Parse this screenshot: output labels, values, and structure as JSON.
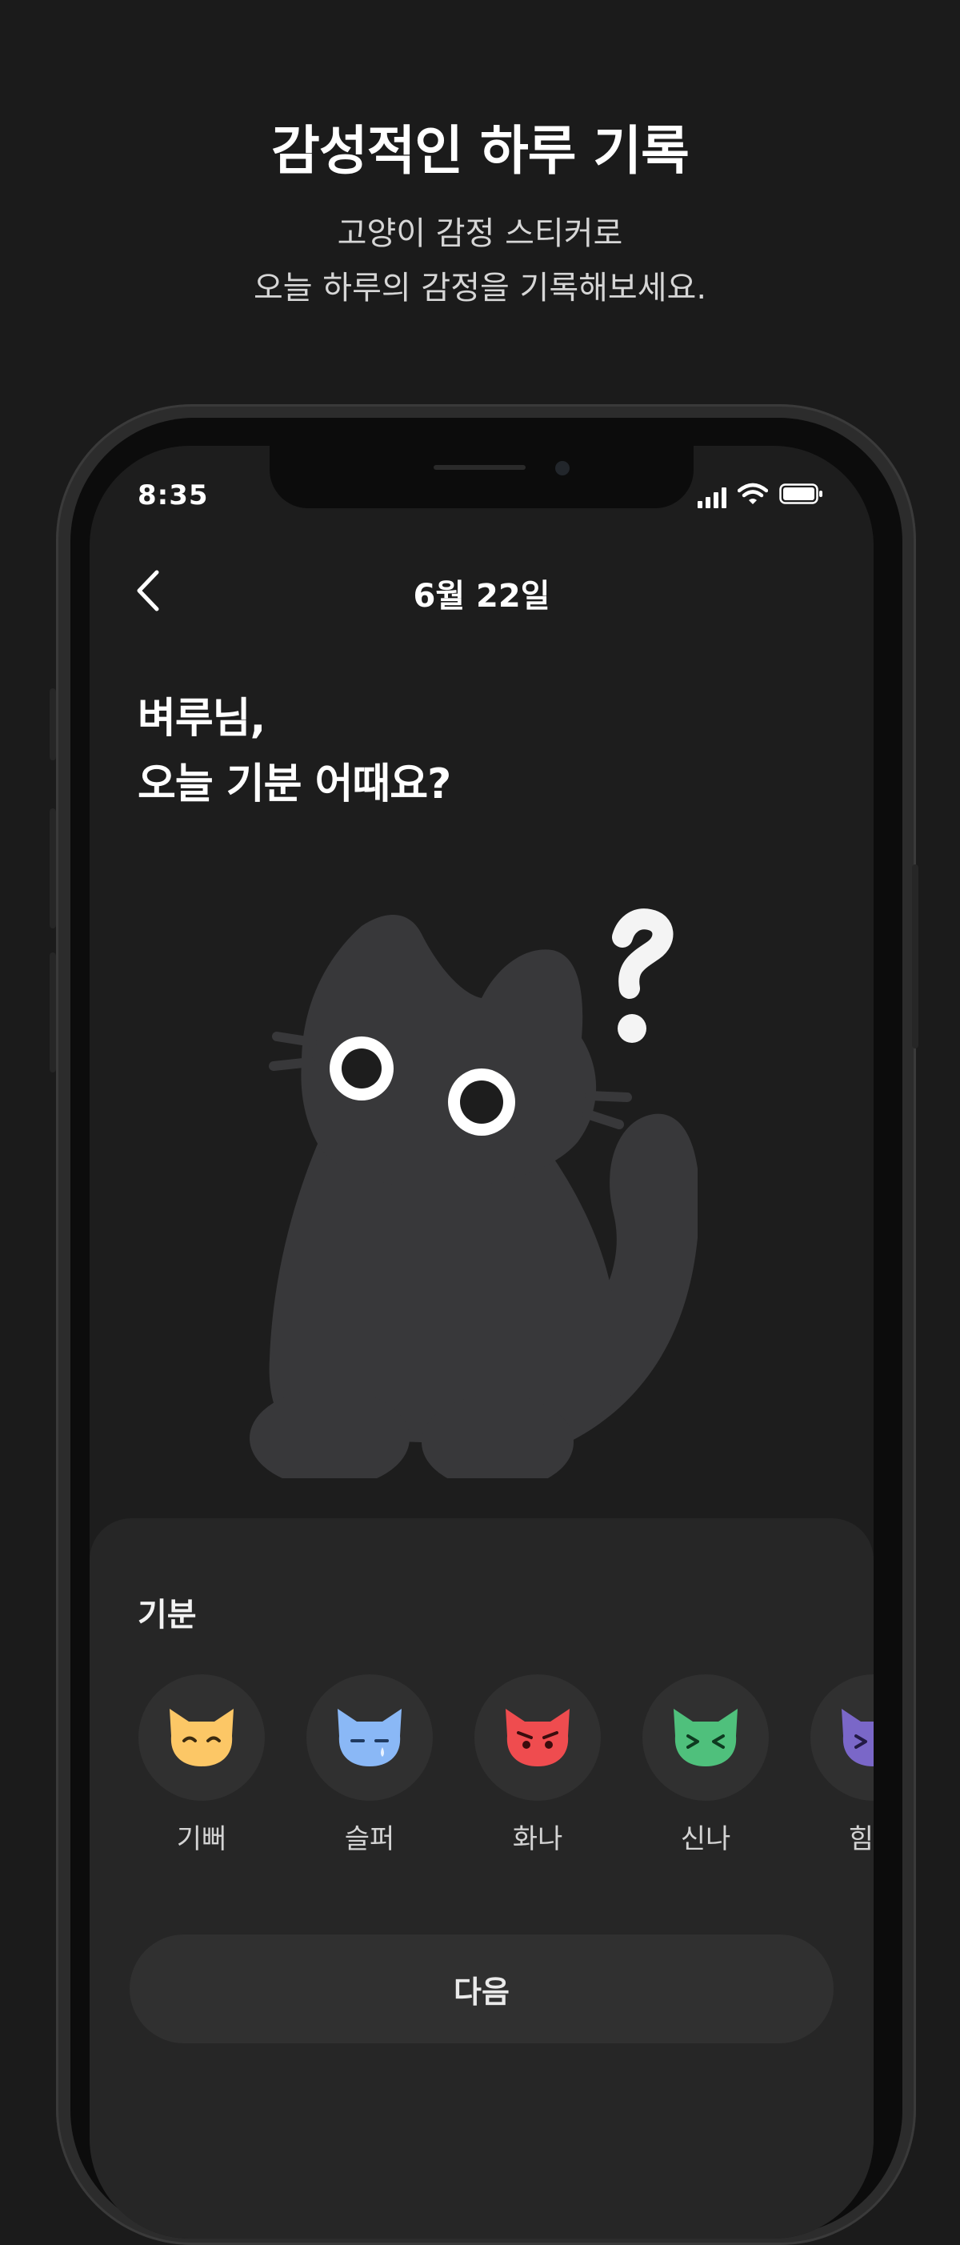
{
  "promo": {
    "title": "감성적인 하루 기록",
    "subtitle_line1": "고양이 감정 스티커로",
    "subtitle_line2": "오늘 하루의 감정을 기록해보세요."
  },
  "status_bar": {
    "time": "8:35",
    "icons": [
      "signal-icon",
      "wifi-icon",
      "battery-icon"
    ]
  },
  "header": {
    "title": "6월 22일",
    "back_icon": "chevron-left-icon"
  },
  "question": {
    "line1": "벼루님,",
    "line2": "오늘 기분 어때요?"
  },
  "mood": {
    "label": "기분",
    "items": [
      {
        "label": "기뻐",
        "icon": "happy-cat-icon",
        "color": "#fcc766"
      },
      {
        "label": "슬퍼",
        "icon": "sad-cat-icon",
        "color": "#8ab8f6"
      },
      {
        "label": "화나",
        "icon": "angry-cat-icon",
        "color": "#ef4c4f"
      },
      {
        "label": "신나",
        "icon": "excited-cat-icon",
        "color": "#4fc07c"
      },
      {
        "label": "힘들",
        "icon": "tired-cat-icon",
        "color": "#7a67c8"
      }
    ]
  },
  "next_button": {
    "label": "다음"
  },
  "colors": {
    "background": "#1b1b1b",
    "screen": "#1d1d1d",
    "panel": "#262626",
    "cat_body": "#38383a"
  }
}
